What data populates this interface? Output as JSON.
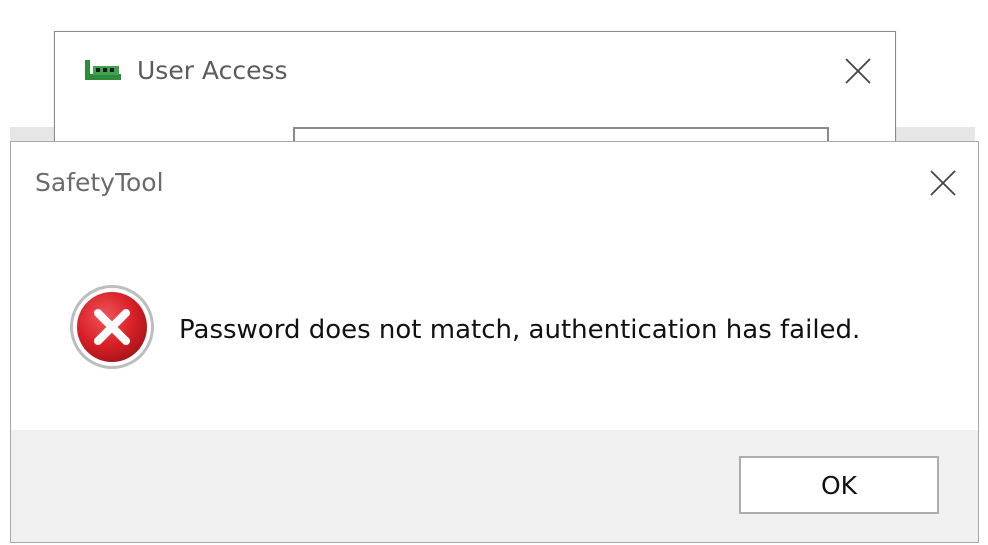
{
  "background_window": {
    "title": "User Access",
    "icon": "app-icon",
    "close_icon": "close-icon",
    "password_value": ""
  },
  "dialog": {
    "title": "SafetyTool",
    "close_icon": "close-icon",
    "icon": "error-icon",
    "message": "Password does not match, authentication has failed.",
    "ok_label": "OK"
  },
  "colors": {
    "error_red": "#d81f26",
    "footer_bg": "#f0f0f0",
    "app_icon_green": "#2e8b3a"
  }
}
